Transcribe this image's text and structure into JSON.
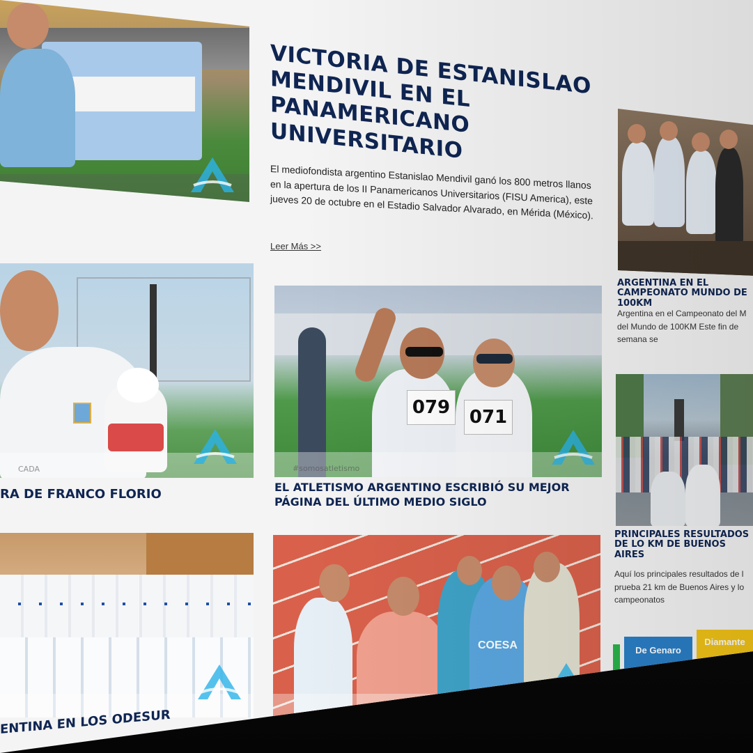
{
  "featured": {
    "title": "VICTORIA DE ESTANISLAO MENDIVIL EN EL PANAMERICANO UNIVERSITARIO",
    "excerpt": "El mediofondista argentino Estanislao Mendivil ganó los 800 metros llanos en la apertura de los II Panamericanos Universitarios (FISU America), este jueves 20 de octubre en el Estadio Salvador Alvarado, en Mérida (México).",
    "read_more": "Leer Más >>"
  },
  "side_articles": [
    {
      "title": "ARGENTINA EN EL CAMPEONATO MUNDO DE 100KM",
      "excerpt": "Argentina en el Campeonato del M del Mundo de 100KM Este fin de semana se"
    },
    {
      "title": "PRINCIPALES RESULTADOS DE LO KM DE BUENOS AIRES",
      "excerpt": "Aquí los principales resultados de l prueba 21 km de Buenos Aires y lo campeonatos"
    }
  ],
  "grid_articles": [
    {
      "title": "RA DE FRANCO FLORIO"
    },
    {
      "title": "EL ATLETISMO ARGENTINO ESCRIBIÓ SU MEJOR PÁGINA DEL ÚLTIMO MEDIO SIGLO",
      "bibs": [
        "079",
        "071"
      ],
      "tag": "#somosatletismo"
    },
    {
      "title": "ENTINA EN LOS ODESUR"
    },
    {
      "title": "",
      "shirt_text": "COESA"
    }
  ],
  "banners": [
    "De Genaro",
    "Diamante"
  ],
  "watermark": "CADA",
  "colors": {
    "title_navy": "#0f2552",
    "watermark_cyan": "#2bb3e8",
    "page_bg": "#f4f4f4",
    "banner_blue": "#2a7fc7",
    "banner_yellow": "#f2c417",
    "track_red": "#d9614b"
  }
}
